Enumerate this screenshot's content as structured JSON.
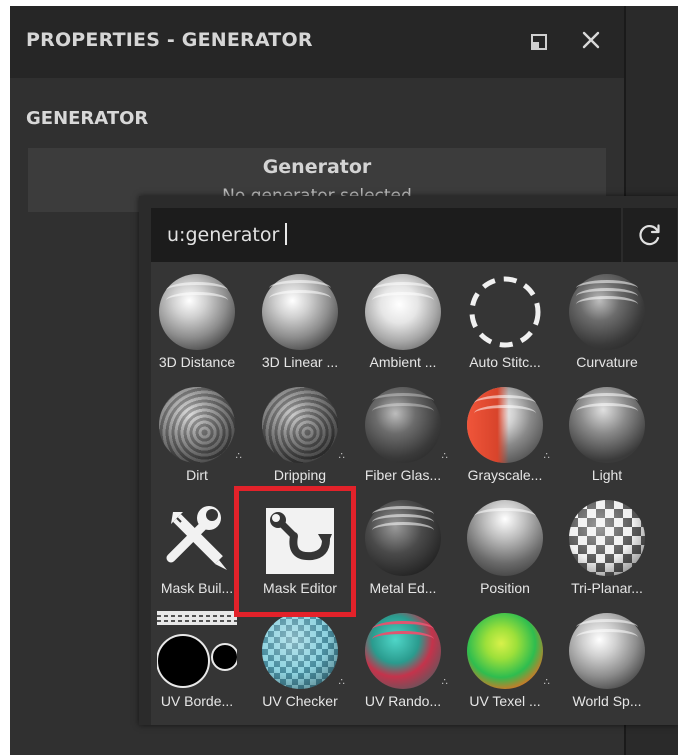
{
  "panel": {
    "title": "PROPERTIES - GENERATOR",
    "section_title": "GENERATOR",
    "generator_box": {
      "title": "Generator",
      "subtitle": "No generator selected"
    }
  },
  "popup": {
    "search_value": "u:generator",
    "items": [
      {
        "label": "3D Distance",
        "icon": "3d-distance-ball"
      },
      {
        "label": "3D Linear ...",
        "icon": "3d-linear-ball"
      },
      {
        "label": "Ambient ...",
        "icon": "ambient-ball"
      },
      {
        "label": "Auto Stitc...",
        "icon": "dashed-circle"
      },
      {
        "label": "Curvature",
        "icon": "curvature-ball"
      },
      {
        "label": "Dirt",
        "icon": "dirt-ball"
      },
      {
        "label": "Dripping",
        "icon": "dripping-ball"
      },
      {
        "label": "Fiber Glas...",
        "icon": "fiber-glass-ball"
      },
      {
        "label": "Grayscale...",
        "icon": "grayscale-ball"
      },
      {
        "label": "Light",
        "icon": "light-ball"
      },
      {
        "label": "Mask Buil...",
        "icon": "wrench-pencil"
      },
      {
        "label": "Mask Editor",
        "icon": "wrench-arrow"
      },
      {
        "label": "Metal Ed...",
        "icon": "metal-edge-ball"
      },
      {
        "label": "Position",
        "icon": "position-ball"
      },
      {
        "label": "Tri-Planar...",
        "icon": "checker-ball"
      },
      {
        "label": "UV Borde...",
        "icon": "uv-border"
      },
      {
        "label": "UV Checker",
        "icon": "uv-checker-ball"
      },
      {
        "label": "UV Rando...",
        "icon": "uv-random-ball"
      },
      {
        "label": "UV Texel ...",
        "icon": "uv-texel-ball"
      },
      {
        "label": "World Sp...",
        "icon": "world-space-ball"
      }
    ]
  },
  "highlight_color": "#e3222a"
}
